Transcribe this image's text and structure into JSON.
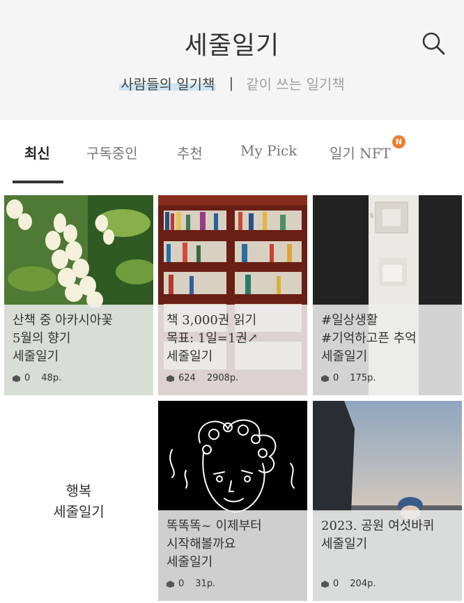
{
  "header": {
    "title": "세줄일기",
    "nav": [
      "사람들의 일기책",
      "|",
      "같이 쓰는 일기책"
    ]
  },
  "tabs": [
    {
      "label": "최신"
    },
    {
      "label": "구독중인"
    },
    {
      "label": "추천"
    },
    {
      "label": "My Pick"
    },
    {
      "label": "일기 NFT",
      "badge": "N"
    }
  ],
  "accent": {
    "badge": "#ef7d2f",
    "highlight": "#cfe6f2"
  },
  "cards": [
    {
      "lines": [
        "산책 중 아카시아꽃",
        "5월의 향기",
        "세줄일기"
      ],
      "count": "0",
      "pages": "48p.",
      "image": "white acacia flowers"
    },
    {
      "lines": [
        "책 3,000권 읽기",
        "목표: 1일=1권↗",
        "세줄일기"
      ],
      "count": "624",
      "pages": "2908p.",
      "image": "bookshelves"
    },
    {
      "lines": [
        "#일상생활",
        "#기억하고픈 추억",
        "세줄일기"
      ],
      "count": "0",
      "pages": "175p.",
      "image": "test strip"
    },
    {
      "lines": [
        "행복",
        "세줄일기"
      ],
      "count": "",
      "pages": "",
      "image": ""
    },
    {
      "lines": [
        "똑똑똑~ 이제부터",
        "시작해볼까요",
        "세줄일기"
      ],
      "count": "0",
      "pages": "31p.",
      "image": "line drawing face"
    },
    {
      "lines": [
        "2023. 공원 여섯바퀴",
        "세줄일기"
      ],
      "count": "0",
      "pages": "204p.",
      "image": "sunset beach"
    }
  ]
}
